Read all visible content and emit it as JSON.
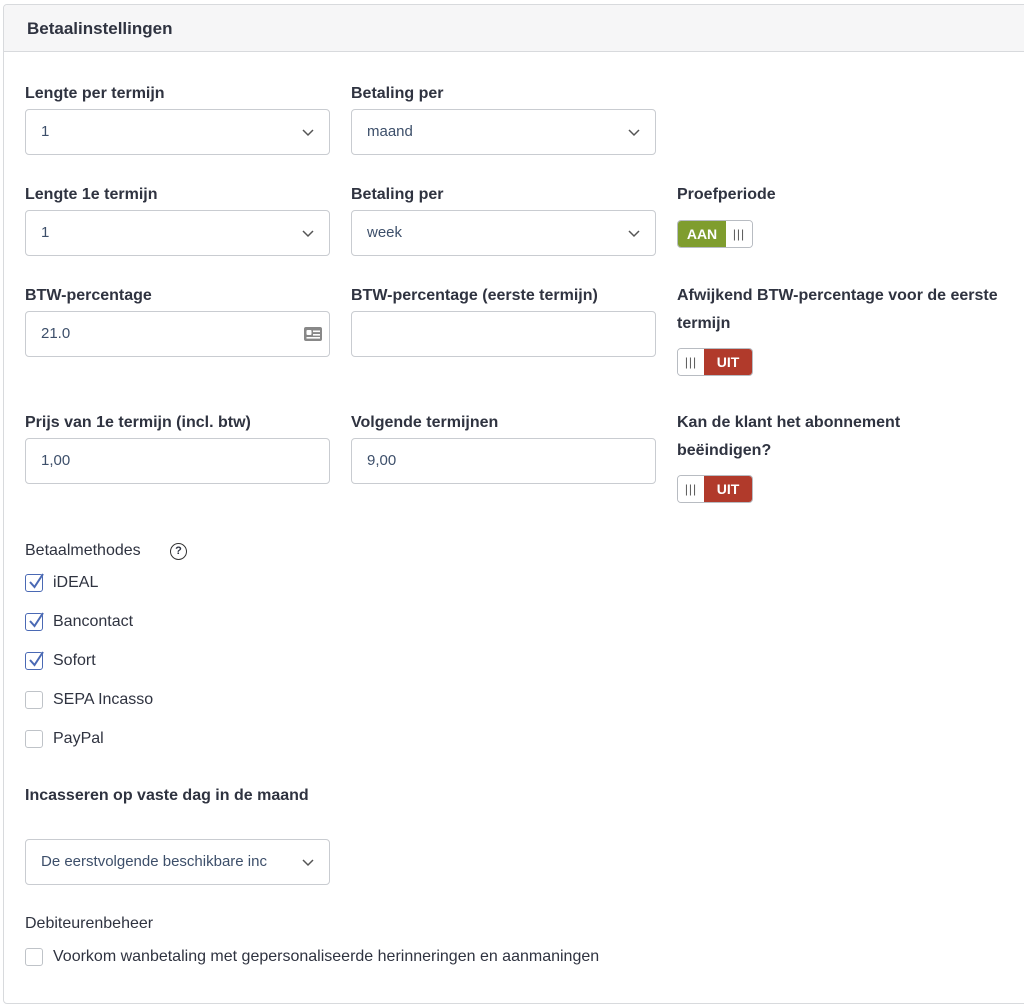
{
  "panel": {
    "title": "Betaalinstellingen"
  },
  "row1": {
    "length_label": "Lengte per termijn",
    "length_value": "1",
    "payment_label": "Betaling per",
    "payment_value": "maand"
  },
  "row2": {
    "length_label": "Lengte 1e termijn",
    "length_value": "1",
    "payment_label": "Betaling per",
    "payment_value": "week",
    "trial_label": "Proefperiode",
    "trial_toggle": "AAN"
  },
  "row3": {
    "vat_label": "BTW-percentage",
    "vat_value": "21.0",
    "vat_first_label": "BTW-percentage (eerste termijn)",
    "vat_first_value": "",
    "deviating_label": "Afwijkend BTW-percentage voor de eerste termijn",
    "deviating_toggle": "UIT"
  },
  "row4": {
    "price_first_label": "Prijs van 1e termijn (incl. btw)",
    "price_first_value": "1,00",
    "next_label": "Volgende termijnen",
    "next_value": "9,00",
    "cancel_label": "Kan de klant het abonnement beëindigen?",
    "cancel_toggle": "UIT"
  },
  "methods": {
    "label": "Betaalmethodes",
    "help": "?",
    "items": [
      {
        "label": "iDEAL",
        "checked": true
      },
      {
        "label": "Bancontact",
        "checked": true
      },
      {
        "label": "Sofort",
        "checked": true
      },
      {
        "label": "SEPA Incasso",
        "checked": false
      },
      {
        "label": "PayPal",
        "checked": false
      }
    ]
  },
  "collection": {
    "label": "Incasseren op vaste dag in de maand",
    "value": "De eerstvolgende beschikbare inc"
  },
  "debtor": {
    "label": "Debiteurenbeheer",
    "option": "Voorkom wanbetaling met gepersonaliseerde herinneringen en aanmaningen"
  },
  "colors": {
    "on": "#7f9d2e",
    "off": "#b13a2b",
    "check": "#4a69b4"
  }
}
